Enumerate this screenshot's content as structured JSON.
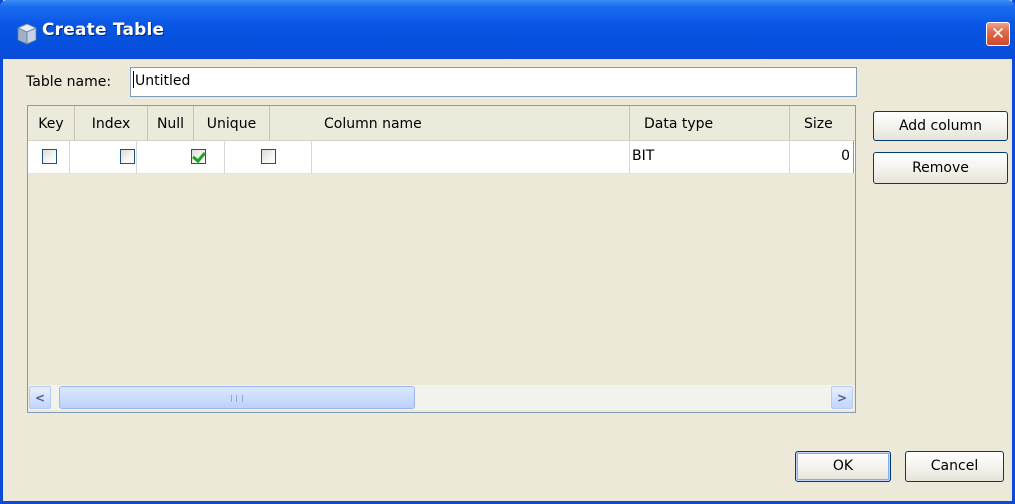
{
  "window": {
    "title": "Create Table",
    "close_label": "✕"
  },
  "form": {
    "table_name_label": "Table name:",
    "table_name_value": "Untitled"
  },
  "table": {
    "columns": [
      "Key",
      "Index",
      "Null",
      "Unique",
      "Column name",
      "Data type",
      "Size"
    ],
    "rows": [
      {
        "key": false,
        "index": false,
        "null": true,
        "unique": false,
        "column_name": "",
        "data_type": "BIT",
        "size": "0"
      }
    ]
  },
  "side_buttons": {
    "add_column": "Add column",
    "remove": "Remove"
  },
  "footer": {
    "ok": "OK",
    "cancel": "Cancel"
  },
  "colors": {
    "titlebar": "#0a57e6",
    "dialog_bg": "#ece9d8",
    "check_mark": "#21a121",
    "close_button": "#d0462b"
  }
}
